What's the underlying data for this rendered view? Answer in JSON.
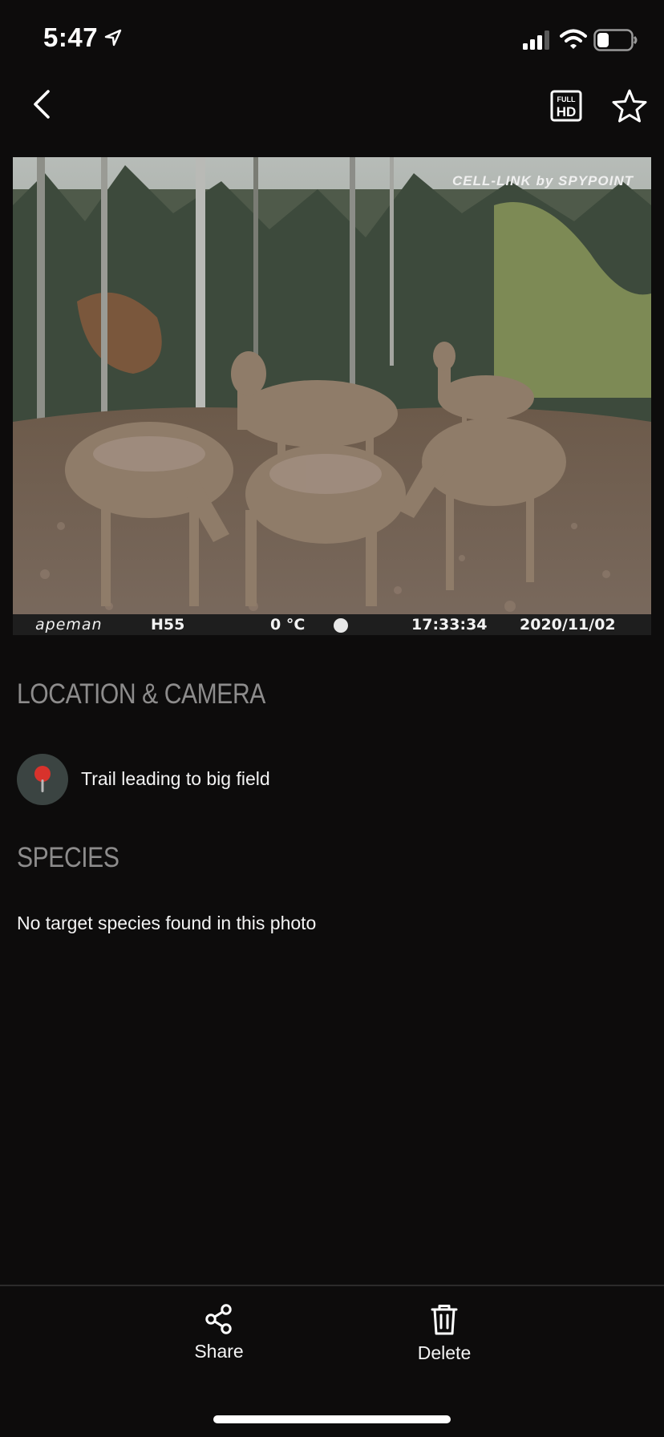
{
  "status_bar": {
    "time": "5:47",
    "battery_level": 0.35
  },
  "nav": {
    "back_icon": "chevron-left-icon",
    "hd_icon": "full-hd-icon",
    "hd_label_top": "FULL",
    "hd_label_bottom": "HD",
    "favorite_icon": "star-icon"
  },
  "photo": {
    "brand_watermark": "CELL-LINK by SPYPOINT",
    "camera_name": "apeman",
    "model": "H55",
    "temperature": "0 °C",
    "time": "17:33:34",
    "date": "2020/11/02"
  },
  "location_section": {
    "title": "LOCATION & CAMERA",
    "location_name": "Trail leading to big field",
    "icon": "map-pin-icon"
  },
  "species_section": {
    "title": "SPECIES",
    "message": "No target species found in this photo"
  },
  "actions": {
    "share_label": "Share",
    "share_icon": "share-icon",
    "delete_label": "Delete",
    "delete_icon": "trash-icon"
  },
  "colors": {
    "background": "#0d0c0c",
    "section_title": "#8d8c8c",
    "text": "#f4f4f4",
    "pin_circle": "#3b4442",
    "pin_red": "#d8322c"
  }
}
